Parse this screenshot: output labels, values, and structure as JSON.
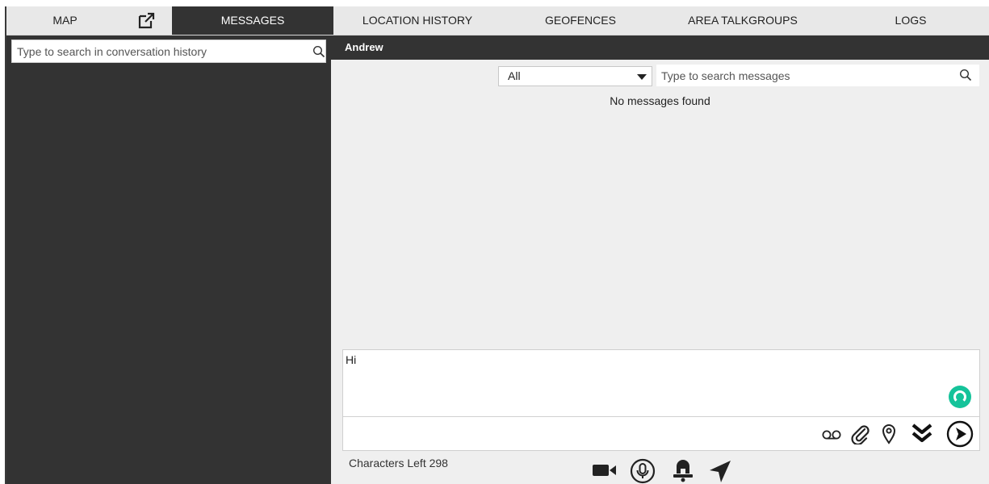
{
  "tabs": [
    {
      "label": "MAP",
      "active": false
    },
    {
      "label": "MESSAGES",
      "active": true
    },
    {
      "label": "LOCATION HISTORY",
      "active": false
    },
    {
      "label": "GEOFENCES",
      "active": false
    },
    {
      "label": "AREA TALKGROUPS",
      "active": false
    },
    {
      "label": "LOGS",
      "active": false
    }
  ],
  "sidebar": {
    "search_placeholder": "Type to search in conversation history"
  },
  "conversation": {
    "contact_name": "Andrew",
    "filter": {
      "selected": "All"
    },
    "search_placeholder": "Type to search messages",
    "empty_text": "No messages found"
  },
  "compose": {
    "value": "Hi",
    "characters_left_label": "Characters Left 298"
  },
  "icons": {
    "popout": "open-in-new-window-icon",
    "voicemail": "voicemail-icon",
    "attach": "paperclip-icon",
    "location_pin": "location-pin-icon",
    "expand": "double-chevron-down-icon",
    "send": "send-icon",
    "video": "video-camera-icon",
    "mic": "microphone-icon",
    "alert": "alert-bell-icon",
    "navigate": "navigation-arrow-icon"
  },
  "colors": {
    "dark_panel": "#333333",
    "tab_bar": "#e8e8e8",
    "main_bg": "#efefef",
    "grammar_badge": "#15c39a"
  }
}
